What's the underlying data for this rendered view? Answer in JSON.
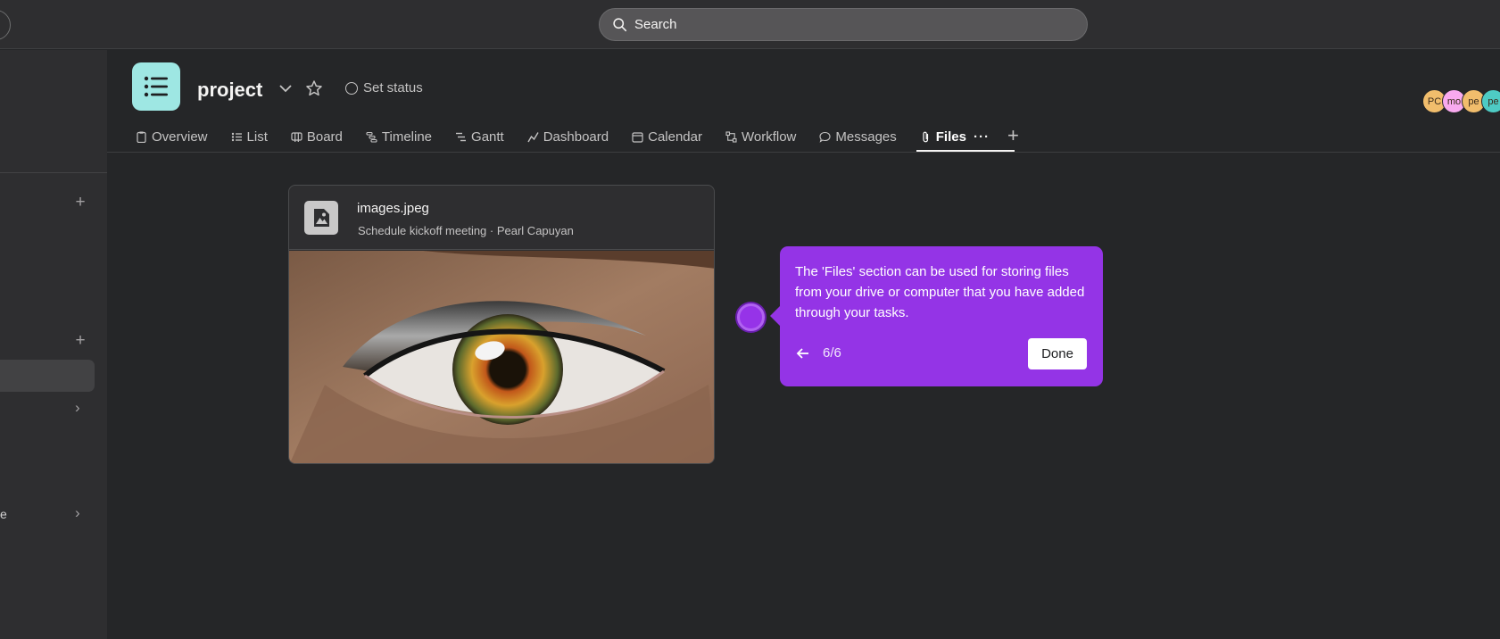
{
  "search": {
    "label": "Search"
  },
  "sidebar": {
    "truncated_item": "e"
  },
  "project": {
    "title": "project",
    "icon_color": "#9ee7e3",
    "set_status": "Set status"
  },
  "avatars": [
    {
      "initials": "PC",
      "color": "#f1bd6c"
    },
    {
      "initials": "mo",
      "color": "#f9aaef"
    },
    {
      "initials": "pe",
      "color": "#f1bd6c"
    },
    {
      "initials": "pe",
      "color": "#4ecbc4"
    }
  ],
  "tabs": [
    {
      "label": "Overview",
      "icon": "clipboard-icon"
    },
    {
      "label": "List",
      "icon": "list-icon"
    },
    {
      "label": "Board",
      "icon": "board-icon"
    },
    {
      "label": "Timeline",
      "icon": "timeline-icon"
    },
    {
      "label": "Gantt",
      "icon": "gantt-icon"
    },
    {
      "label": "Dashboard",
      "icon": "dashboard-icon"
    },
    {
      "label": "Calendar",
      "icon": "calendar-icon"
    },
    {
      "label": "Workflow",
      "icon": "workflow-icon"
    },
    {
      "label": "Messages",
      "icon": "message-icon"
    },
    {
      "label": "Files",
      "icon": "paperclip-icon",
      "active": true
    }
  ],
  "file_card": {
    "name": "images.jpeg",
    "subtitle": "Schedule kickoff meeting · Pearl Capuyan"
  },
  "tooltip": {
    "text": "The 'Files' section can be used for storing files from your drive or computer that you have added through your tasks.",
    "step": "6/6",
    "done_label": "Done",
    "color": "#9434e6"
  }
}
